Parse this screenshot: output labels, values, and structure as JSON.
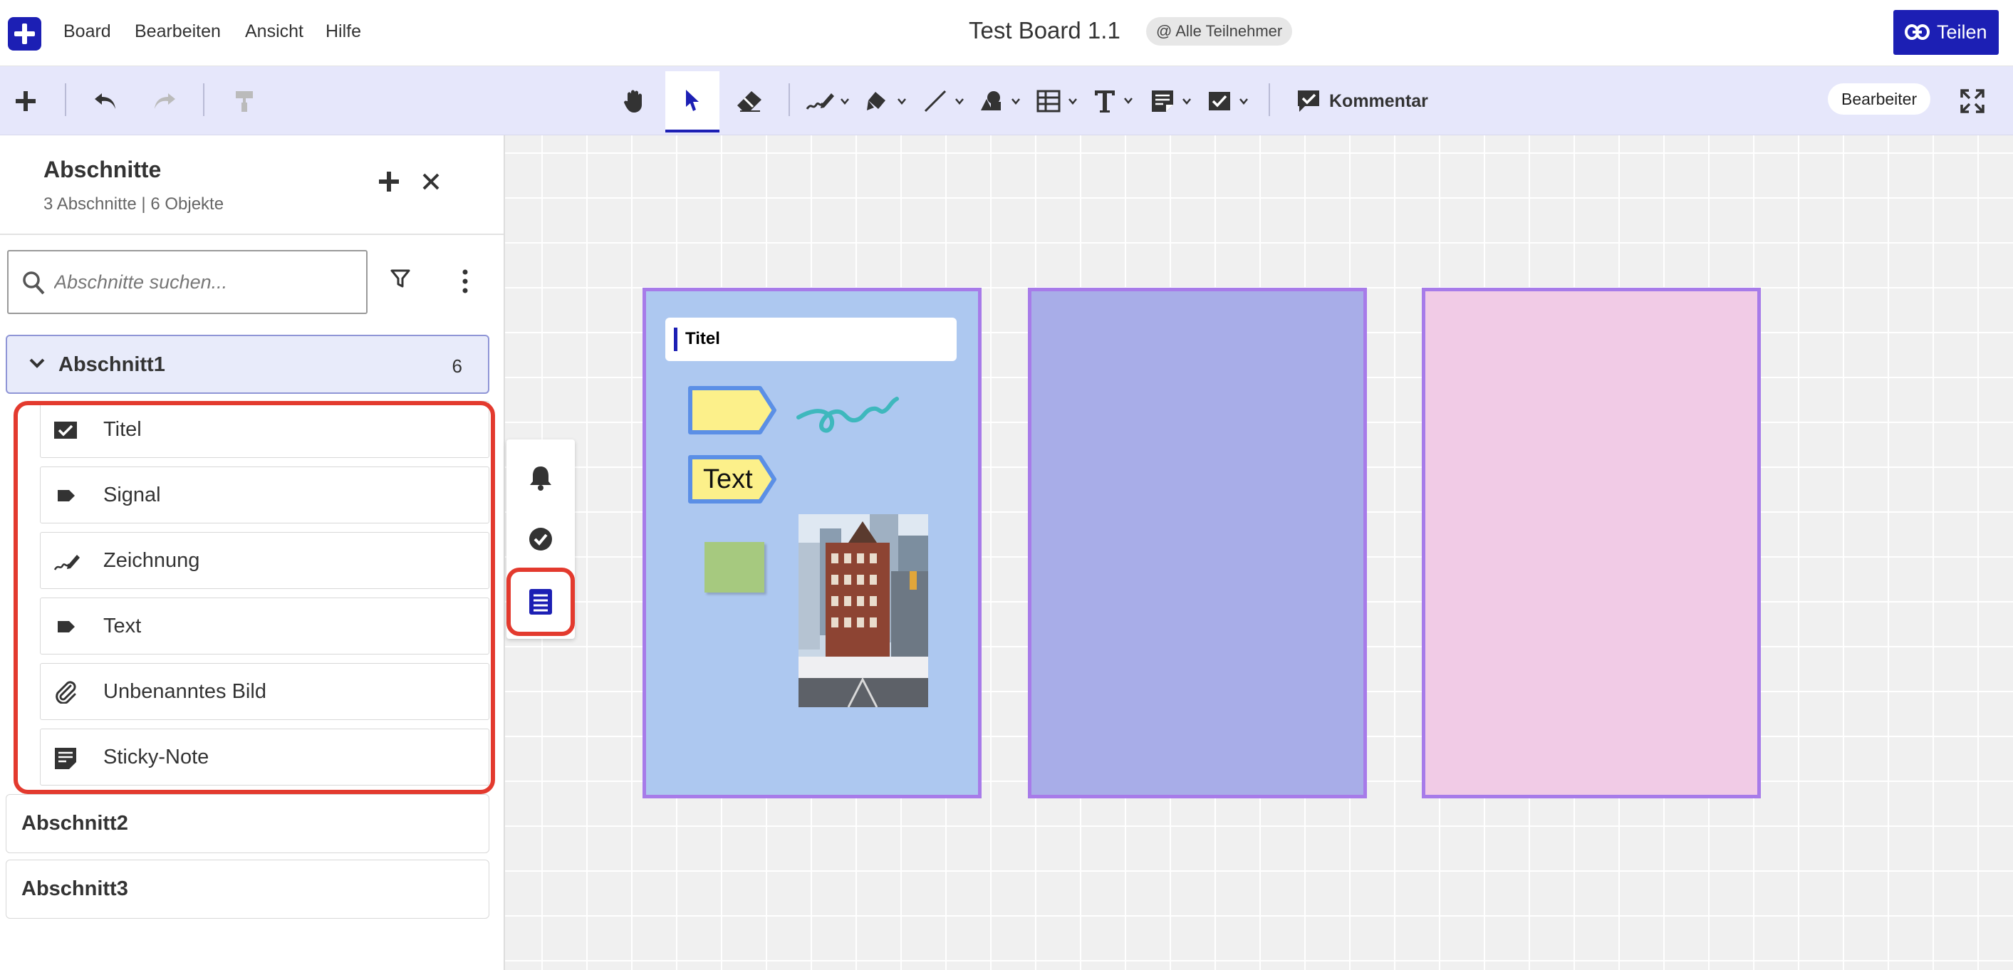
{
  "menubar": {
    "logo": "plus-logo-icon",
    "menus": [
      "Board",
      "Bearbeiten",
      "Ansicht",
      "Hilfe"
    ],
    "board_title": "Test Board 1.1",
    "participants_badge": "@ Alle Teilnehmer",
    "share_label": "Teilen",
    "brand_color": "#1c1fb4"
  },
  "toolbar": {
    "tools": [
      "add-icon",
      "undo-icon",
      "redo-icon",
      "format-painter-icon",
      "hand-icon",
      "select-pointer-icon",
      "eraser-icon",
      "pen-icon",
      "highlighter-icon",
      "line-icon",
      "shapes-icon",
      "table-icon",
      "text-icon",
      "sticky-note-icon",
      "title-card-icon"
    ],
    "active_tool": "select-pointer-icon",
    "comment_label": "Kommentar",
    "role_label": "Bearbeiter"
  },
  "sidebar": {
    "title": "Abschnitte",
    "subtitle": "3 Abschnitte | 6 Objekte",
    "search_placeholder": "Abschnitte suchen...",
    "sections": [
      {
        "label": "Abschnitt1",
        "count": "6",
        "expanded": true,
        "items": [
          {
            "label": "Titel",
            "icon": "title-card-icon"
          },
          {
            "label": "Signal",
            "icon": "tag-icon"
          },
          {
            "label": "Zeichnung",
            "icon": "pen-icon"
          },
          {
            "label": "Text",
            "icon": "tag-icon"
          },
          {
            "label": "Unbenanntes Bild",
            "icon": "paperclip-icon"
          },
          {
            "label": "Sticky-Note",
            "icon": "sticky-note-icon"
          }
        ]
      },
      {
        "label": "Abschnitt2",
        "expanded": false
      },
      {
        "label": "Abschnitt3",
        "expanded": false
      }
    ]
  },
  "dock": {
    "buttons": [
      "bell-icon",
      "check-circle-icon",
      "list-icon"
    ],
    "highlighted": "list-icon"
  },
  "canvas": {
    "frame_colors": [
      "#adc8f0",
      "#a8ade8",
      "#f1cbe6"
    ],
    "frame_border_color": "#a77be9",
    "title_card_label": "Titel",
    "text_tag_label": "Text",
    "tag_color": "#fcf08a",
    "sticky_color": "#a6c97f",
    "highlight_color": "#e33a2e"
  }
}
